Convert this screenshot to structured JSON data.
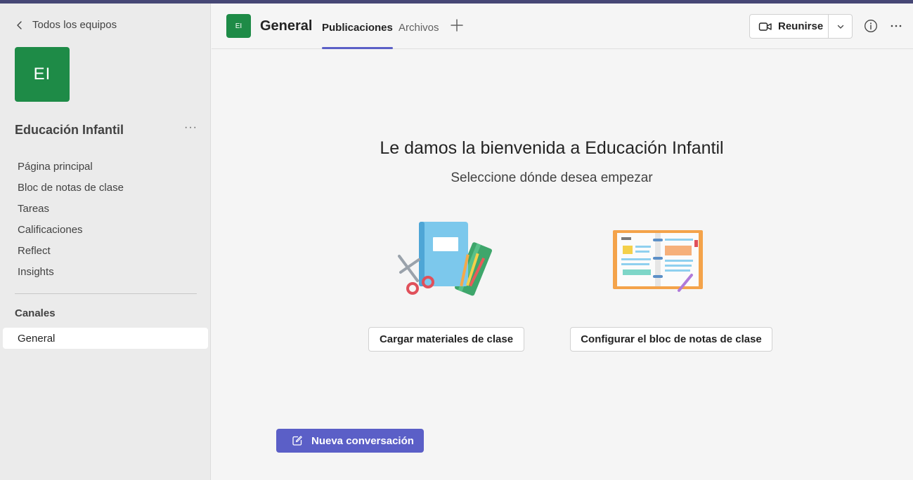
{
  "sidebar": {
    "back_label": "Todos los equipos",
    "team_initials": "EI",
    "team_name": "Educación Infantil",
    "more_label": "···",
    "nav_items": [
      "Página principal",
      "Bloc de notas de clase",
      "Tareas",
      "Calificaciones",
      "Reflect",
      "Insights"
    ],
    "channels_heading": "Canales",
    "channels": [
      "General"
    ]
  },
  "header": {
    "channel_initials": "EI",
    "channel_title": "General",
    "tabs": [
      "Publicaciones",
      "Archivos"
    ],
    "meet_label": "Reunirse"
  },
  "main": {
    "welcome_title": "Le damos la bienvenida a Educación Infantil",
    "welcome_subtitle": "Seleccione dónde desea empezar",
    "upload_button": "Cargar materiales de clase",
    "notebook_button": "Configurar el bloc de notas de clase",
    "new_conversation": "Nueva conversación"
  },
  "colors": {
    "accent": "#5b5fc7",
    "team_green": "#1e8b47",
    "top_bar": "#464775"
  },
  "icons": [
    "chevron-left-icon",
    "plus-icon",
    "video-camera-icon",
    "chevron-down-icon",
    "info-icon",
    "more-icon",
    "compose-icon"
  ]
}
